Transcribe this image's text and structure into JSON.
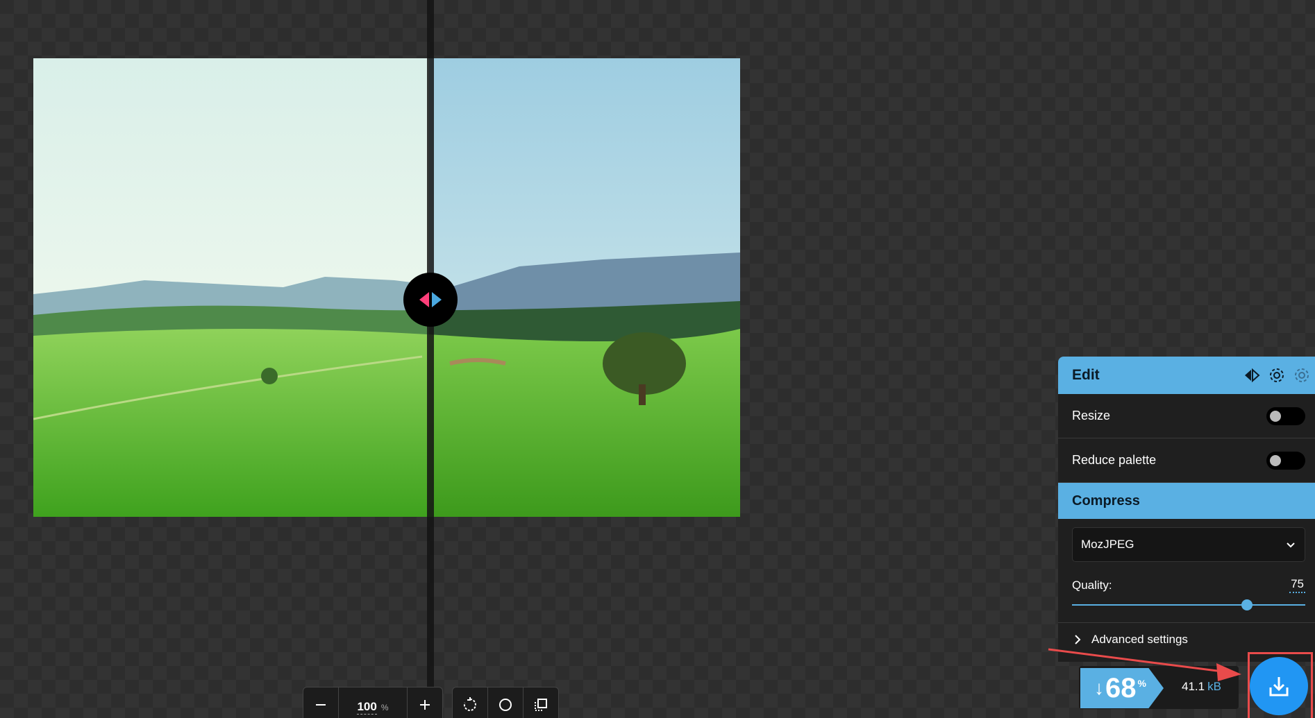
{
  "toolbar": {
    "zoom_value": "100",
    "zoom_unit": "%",
    "icons": {
      "zoom_out": "minus-icon",
      "zoom_in": "plus-icon",
      "rotate": "rotate-icon",
      "background": "circle-icon",
      "crop": "crop-icon"
    }
  },
  "panel": {
    "edit_title": "Edit",
    "header_icons": [
      "swap-sides-icon",
      "settings-icon",
      "settings-icon"
    ],
    "resize_label": "Resize",
    "resize_enabled": false,
    "reduce_palette_label": "Reduce palette",
    "reduce_palette_enabled": false,
    "compress_title": "Compress",
    "codec": "MozJPEG",
    "quality_label": "Quality:",
    "quality_value": "75",
    "advanced_label": "Advanced settings"
  },
  "result": {
    "savings_arrow": "↓",
    "savings_value": "68",
    "savings_unit": "%",
    "size_value": "41.1",
    "size_unit": "kB"
  },
  "colors": {
    "accent": "#5ab0e3",
    "download": "#2196f3",
    "annotation": "#e94b4b"
  }
}
